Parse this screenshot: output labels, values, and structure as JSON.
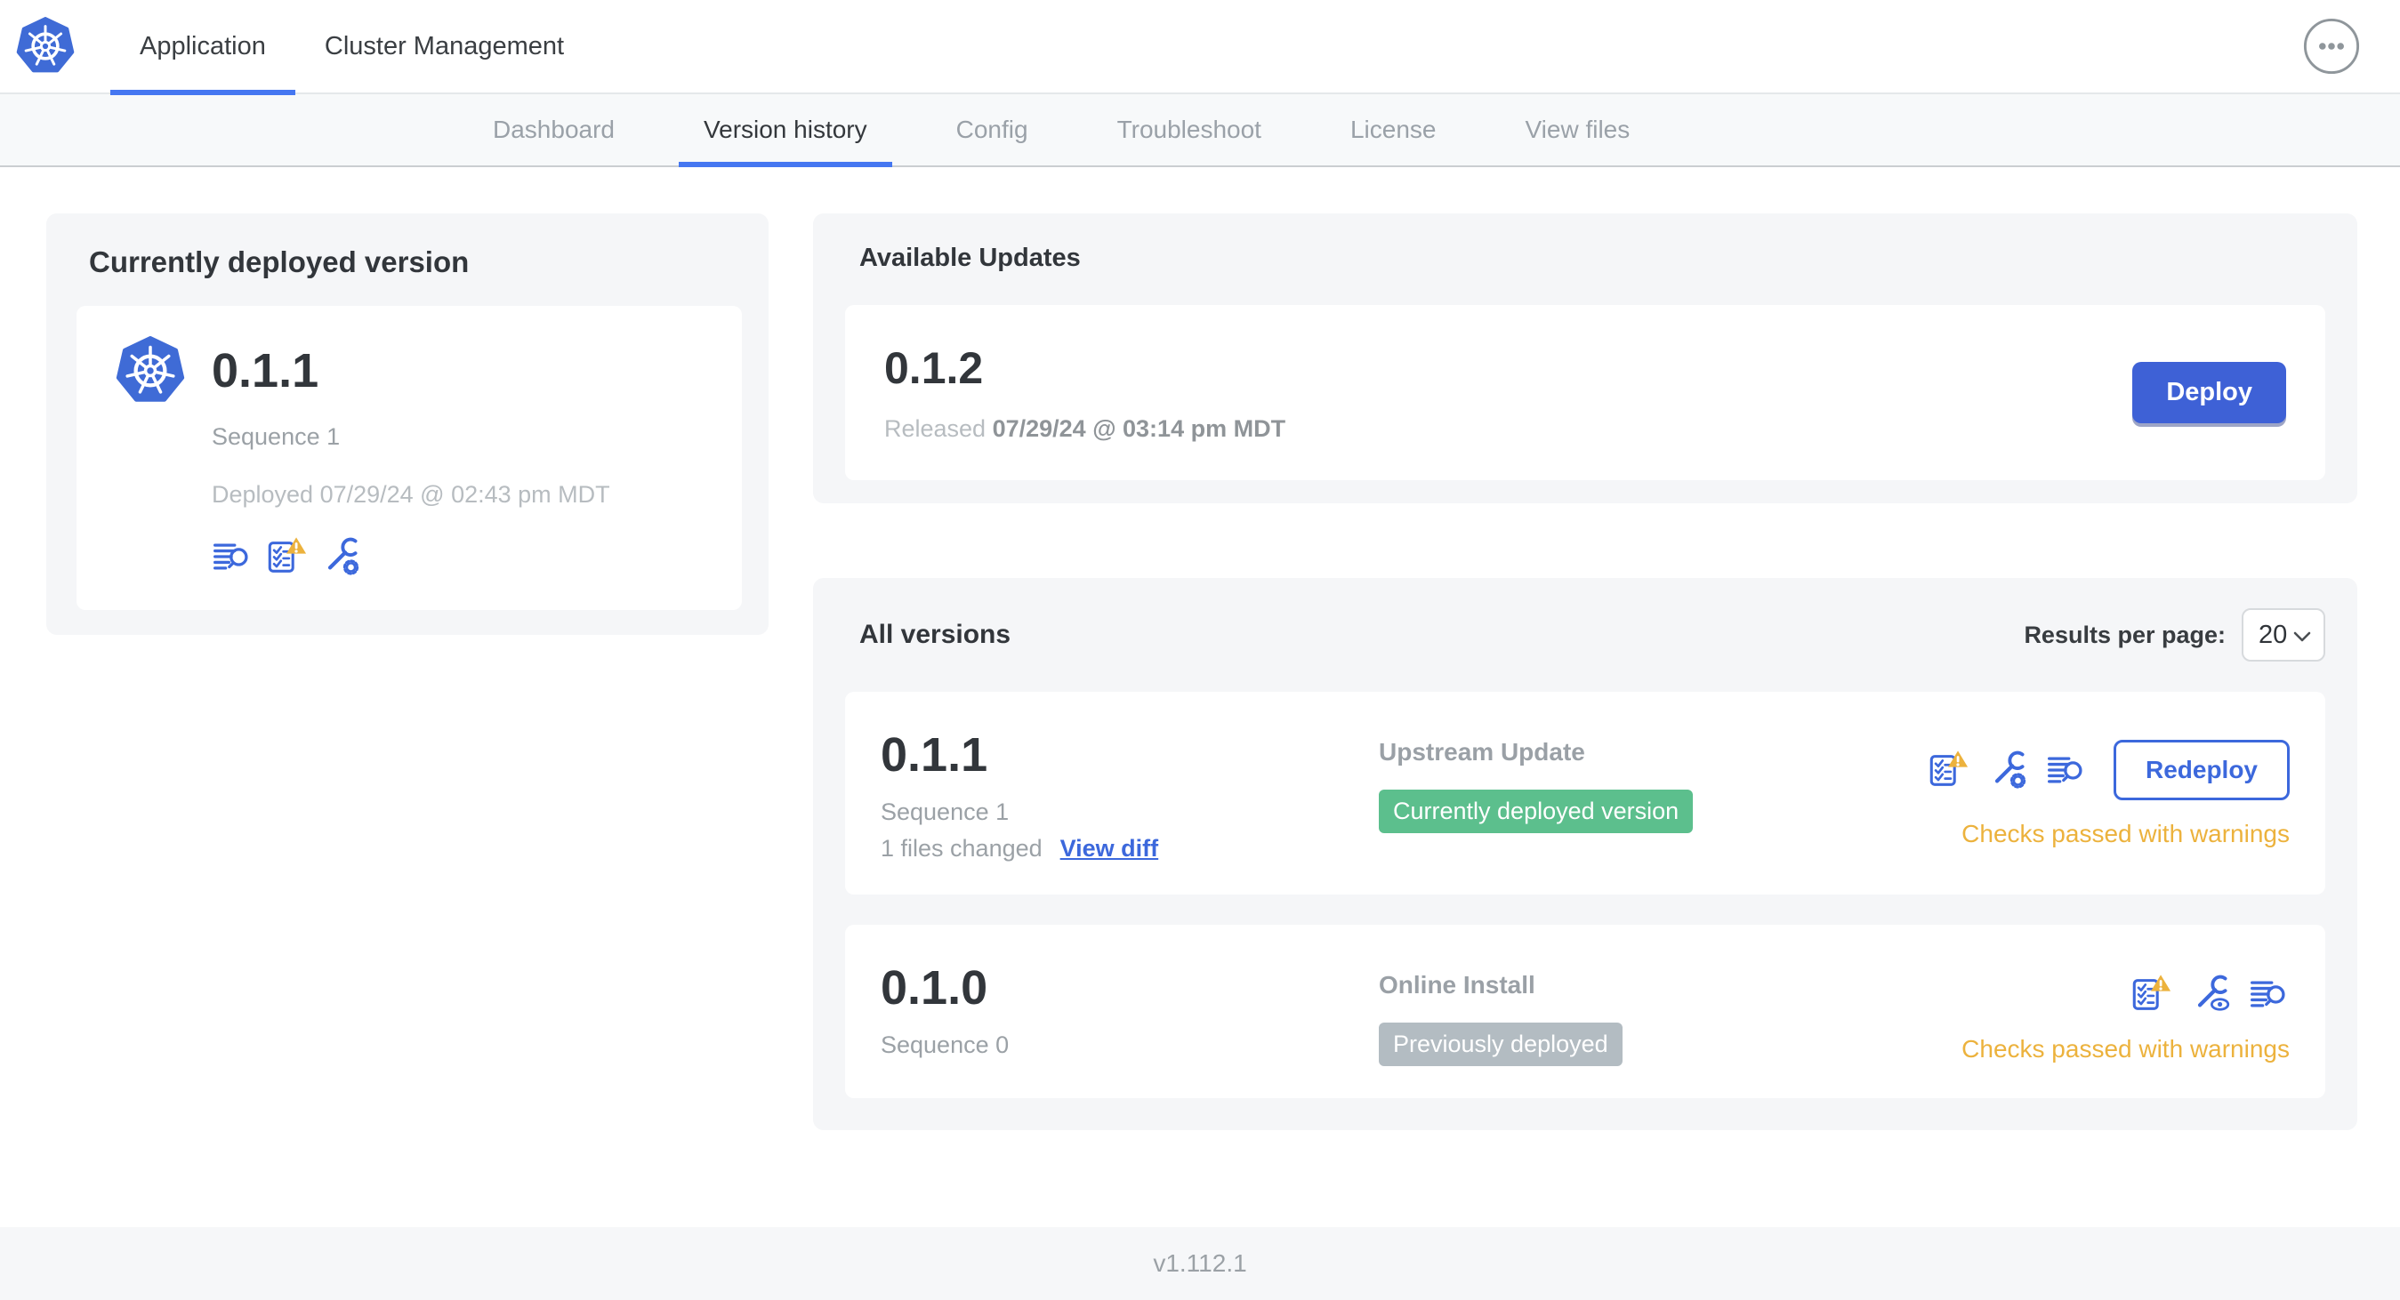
{
  "colors": {
    "accent_blue": "#3e61d6",
    "link_blue": "#3c68dc",
    "underline_blue": "#4577f1",
    "k8s_blue": "#3f6bd6",
    "badge_green": "#5cbf8d",
    "badge_gray": "#b3bcc2",
    "warning_amber": "#ecb23d",
    "panel_gray": "#f5f6f8"
  },
  "topnav": {
    "tabs": [
      {
        "label": "Application",
        "active": true
      },
      {
        "label": "Cluster Management",
        "active": false
      }
    ],
    "menu_icon": "ellipsis-icon"
  },
  "subnav": {
    "items": [
      {
        "label": "Dashboard",
        "active": false
      },
      {
        "label": "Version history",
        "active": true
      },
      {
        "label": "Config",
        "active": false
      },
      {
        "label": "Troubleshoot",
        "active": false
      },
      {
        "label": "License",
        "active": false
      },
      {
        "label": "View files",
        "active": false
      }
    ]
  },
  "deployed_panel": {
    "title": "Currently deployed version",
    "version": "0.1.1",
    "sequence": "Sequence 1",
    "deployed_at": "Deployed 07/29/24 @ 02:43 pm MDT",
    "icons": [
      "deploy-logs-icon",
      "preflight-checks-warning-icon",
      "edit-config-icon"
    ]
  },
  "available_updates": {
    "title": "Available Updates",
    "version": "0.1.2",
    "released_label": "Released",
    "released_at": "07/29/24 @ 03:14 pm MDT",
    "deploy_button": "Deploy"
  },
  "all_versions": {
    "title": "All versions",
    "results_per_page_label": "Results per page:",
    "results_per_page_value": "20",
    "rows": [
      {
        "version": "0.1.1",
        "sequence": "Sequence 1",
        "files_changed": "1 files changed",
        "view_diff": "View diff",
        "source": "Upstream Update",
        "badge": "Currently deployed version",
        "badge_color": "#5cbf8d",
        "action": "Redeploy",
        "status": "Checks passed with warnings",
        "icons": [
          "preflight-checks-warning-icon",
          "edit-config-icon",
          "deploy-logs-icon"
        ]
      },
      {
        "version": "0.1.0",
        "sequence": "Sequence 0",
        "source": "Online Install",
        "badge": "Previously deployed",
        "badge_color": "#b3bcc2",
        "status": "Checks passed with warnings",
        "icons": [
          "preflight-checks-warning-icon",
          "view-config-icon",
          "deploy-logs-icon"
        ]
      }
    ]
  },
  "footer": {
    "version": "v1.112.1"
  }
}
